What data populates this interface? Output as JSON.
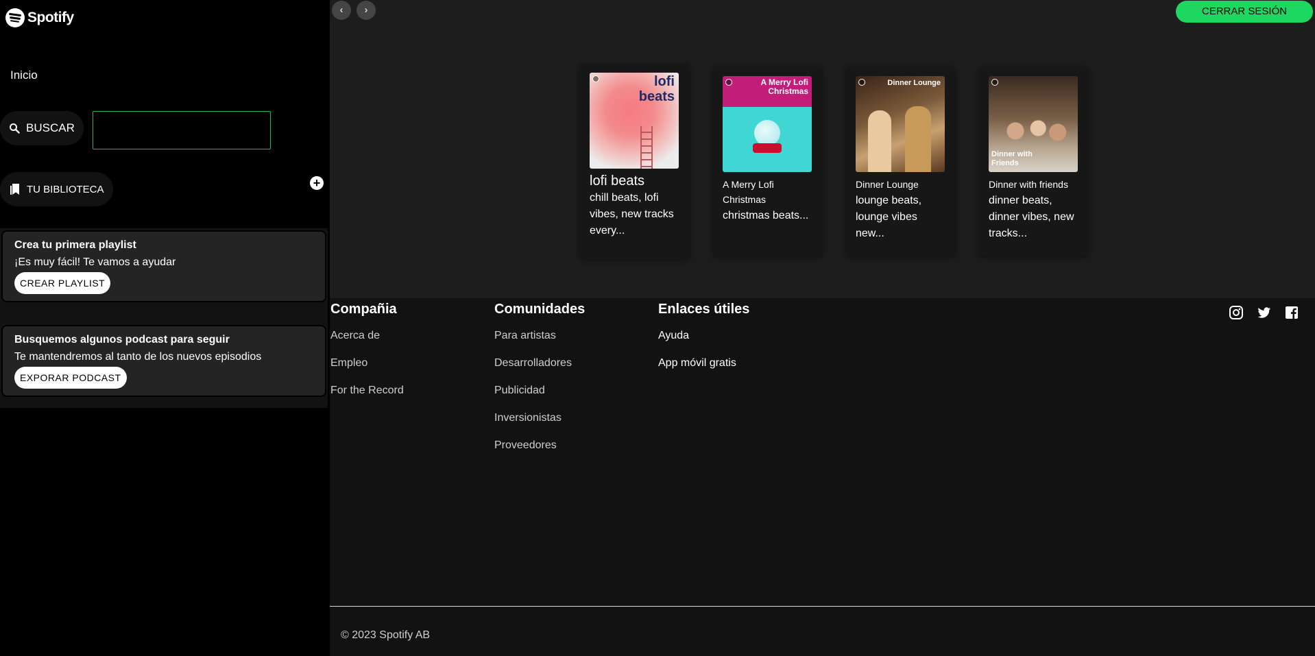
{
  "brand": {
    "name": "Spotify"
  },
  "sidebar": {
    "home_label": "Inicio",
    "search_label": "BUSCAR",
    "search_input": {
      "value": "",
      "placeholder": ""
    },
    "library_label": "TU BIBLIOTECA",
    "add_symbol": "+",
    "cards": [
      {
        "title": "Crea tu primera playlist",
        "text": "¡Es muy fácil! Te vamos a ayudar",
        "button": "CREAR PLAYLIST"
      },
      {
        "title": "Busquemos algunos podcast para seguir",
        "text": "Te mantendremos al tanto de los nuevos episodios",
        "button": "EXPORAR PODCAST"
      }
    ]
  },
  "topbar": {
    "back_symbol": "‹",
    "forward_symbol": "›",
    "logout_label": "CERRAR SESIÓN"
  },
  "playlists": [
    {
      "cover_text": "lofi beats",
      "title": "lofi beats",
      "desc": "chill beats, lofi vibes, new tracks every..."
    },
    {
      "cover_text": "A Merry Lofi Christmas",
      "title": "A Merry Lofi Christmas",
      "desc": "christmas beats..."
    },
    {
      "cover_text": "Dinner Lounge",
      "title": "Dinner Lounge",
      "desc": "lounge beats, lounge vibes new..."
    },
    {
      "cover_text": "Dinner with Friends",
      "title": "Dinner with friends",
      "desc": "dinner beats, dinner vibes, new tracks..."
    }
  ],
  "footer": {
    "columns": [
      {
        "heading": "Compañia",
        "links": [
          "Acerca de",
          "Empleo",
          "For the Record"
        ]
      },
      {
        "heading": "Comunidades",
        "links": [
          "Para artistas",
          "Desarrolladores",
          "Publicidad",
          "Inversionistas",
          "Proveedores"
        ]
      },
      {
        "heading": "Enlaces útiles",
        "links": [
          "Ayuda",
          "App móvil gratis"
        ]
      }
    ],
    "social": [
      "instagram-icon",
      "twitter-icon",
      "facebook-icon"
    ],
    "copyright": "© 2023 Spotify AB"
  },
  "colors": {
    "accent": "#1ed760",
    "sidebar_bg": "#000000",
    "main_bg": "#1d1d1d",
    "footer_bg": "#121212",
    "card_bg": "#242424"
  }
}
